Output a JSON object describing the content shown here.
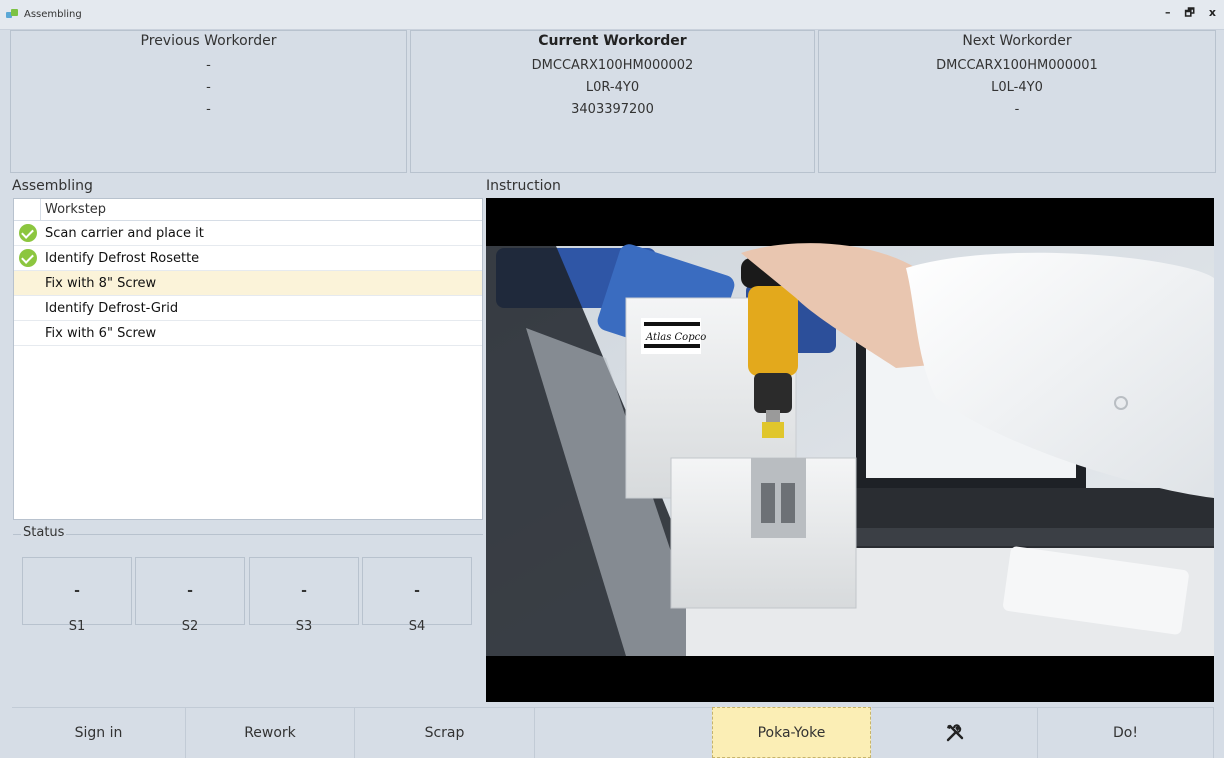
{
  "window": {
    "title": "Assembling",
    "minimize": "–",
    "restore": "🗗",
    "close": "x"
  },
  "previous_workorder": {
    "title": "Previous Workorder",
    "lines": [
      "-",
      "-",
      "-"
    ]
  },
  "current_workorder": {
    "title": "Current Workorder",
    "lines": [
      "DMCCARX100HM000002",
      "L0R-4Y0",
      "3403397200"
    ]
  },
  "next_workorder": {
    "title": "Next Workorder",
    "lines": [
      "DMCCARX100HM000001",
      "L0L-4Y0",
      "-"
    ]
  },
  "assembling": {
    "label": "Assembling",
    "column_header": "Workstep",
    "steps": [
      {
        "label": "Scan carrier and place it",
        "done": true
      },
      {
        "label": "Identify Defrost Rosette",
        "done": true
      },
      {
        "label": "Fix with 8\" Screw",
        "done": false,
        "active": true
      },
      {
        "label": "Identify Defrost-Grid",
        "done": false
      },
      {
        "label": "Fix with 6\" Screw",
        "done": false
      }
    ]
  },
  "instruction": {
    "label": "Instruction",
    "brand_text": "Atlas Copco"
  },
  "status": {
    "label": "Status",
    "slots": [
      {
        "value": "-",
        "label": "S1"
      },
      {
        "value": "-",
        "label": "S2"
      },
      {
        "value": "-",
        "label": "S3"
      },
      {
        "value": "-",
        "label": "S4"
      }
    ]
  },
  "buttons": {
    "sign_in": "Sign in",
    "rework": "Rework",
    "scrap": "Scrap",
    "poka_yoke": "Poka-Yoke",
    "tools_icon": "tools-icon",
    "do": "Do!"
  },
  "colors": {
    "background": "#d6dde6",
    "check": "#8cc63f",
    "active_row": "#fbf3d9",
    "poka_yoke": "#fbeeb5"
  }
}
